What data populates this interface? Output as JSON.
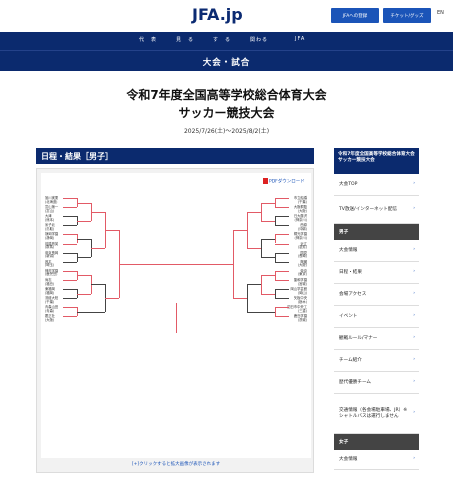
{
  "header": {
    "logo": "JFA.jp",
    "register_label": "JFAへの登録",
    "ticket_label": "チケット/グッズ",
    "lang_label": "EN"
  },
  "nav": {
    "items": [
      "代　表",
      "見　る",
      "す　る",
      "関わる",
      "JFA"
    ]
  },
  "banner": {
    "label": "大会・試合"
  },
  "page": {
    "title_line1": "令和7年度全国高等学校総合体育大会",
    "title_line2": "サッカー競技大会",
    "dates": "2025/7/26(土)～2025/8/2(土)"
  },
  "section": {
    "heading": "日程・結果［男子］",
    "pdf_label": "PDFダウンロード",
    "caption": "[+]クリックすると拡大画像が表示されます"
  },
  "bracket": {
    "left_teams": [
      "旭川実業",
      "(北海道)",
      "富山第一",
      "(富山)",
      "大津",
      "(熊本)",
      "米子北",
      "(鳥取)",
      "静岡学園",
      "(静岡)",
      "前橋育英",
      "(群馬)",
      "帝京長岡",
      "(新潟)",
      "昌平",
      "(埼玉)",
      "神村学園",
      "(鹿児島)",
      "尚志",
      "(福島)",
      "東福岡",
      "(福岡)",
      "流経大柏",
      "(千葉)",
      "青森山田",
      "(青森)",
      "履正社",
      "(大阪)"
    ],
    "right_teams": [
      "市立船橋",
      "(千葉)",
      "大阪桐蔭",
      "(大阪)",
      "日大藤沢",
      "(神奈川)",
      "西原",
      "(沖縄)",
      "桐光学園",
      "(神奈川)",
      "近江",
      "(滋賀)",
      "国見",
      "(長崎)",
      "興國",
      "(大阪)",
      "帝京",
      "(東京)",
      "聖和学園",
      "(宮城)",
      "岡山学芸館",
      "(岡山)",
      "矢板中央",
      "(栃木)",
      "四日市中央工",
      "(三重)",
      "鹿島学園",
      "(茨城)"
    ]
  },
  "sidebar": {
    "heading": "令和7年度全国高等学校総合体育大会サッカー競技大会",
    "items_top": [
      {
        "label": "大会TOP"
      },
      {
        "label": "TV放送/インターネット配信"
      }
    ],
    "group_boys": "男子",
    "items_boys": [
      {
        "label": "大会情報"
      },
      {
        "label": "日程・結果"
      },
      {
        "label": "会場アクセス"
      },
      {
        "label": "イベント"
      },
      {
        "label": "観戦ルール/マナー"
      },
      {
        "label": "チーム紹介"
      },
      {
        "label": "歴代優勝チーム"
      },
      {
        "label": "交通情報（各会場駐車場、JR）※シャトルバスは運行しません"
      }
    ],
    "group_girls": "女子",
    "items_girls": [
      {
        "label": "大会情報"
      }
    ]
  },
  "colors": {
    "navy": "#0b2a6e",
    "accent_blue": "#1b54b8",
    "bracket_line": "#e25a66"
  }
}
